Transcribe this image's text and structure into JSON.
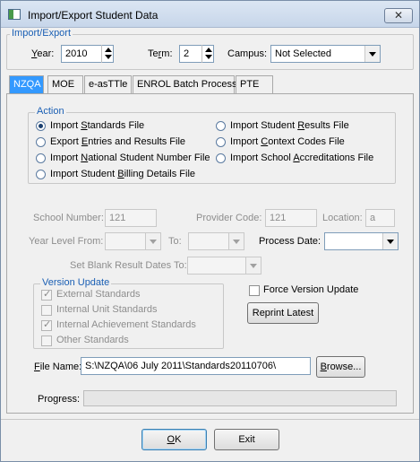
{
  "window": {
    "title": "Import/Export Student Data",
    "close_label": "✕"
  },
  "import_export": {
    "legend": "Import/Export",
    "year_label": "Year:",
    "year_value": "2010",
    "term_label": "Term:",
    "term_value": "2",
    "campus_label": "Campus:",
    "campus_value": "Not Selected"
  },
  "tabs": [
    "NZQA",
    "MOE",
    "e-asTTle",
    "ENROL Batch Process",
    "PTE"
  ],
  "action": {
    "legend": "Action",
    "options": [
      "Import Standards File",
      "Export Entries and Results File",
      "Import National Student Number File",
      "Import Student Billing Details File",
      "Import Student Results File",
      "Import Context Codes File",
      "Import School Accreditations File"
    ],
    "selected": "Import Standards File"
  },
  "fields": {
    "school_number_label": "School Number:",
    "school_number_value": "121",
    "provider_code_label": "Provider Code:",
    "provider_code_value": "121",
    "location_label": "Location:",
    "location_value": "a",
    "year_level_from_label": "Year Level From:",
    "to_label": "To:",
    "process_date_label": "Process Date:",
    "blank_result_label": "Set Blank Result Dates To:"
  },
  "version_update": {
    "legend": "Version Update",
    "options": [
      {
        "label": "External Standards",
        "checked": true
      },
      {
        "label": "Internal Unit Standards",
        "checked": false
      },
      {
        "label": "Internal Achievement Standards",
        "checked": true
      },
      {
        "label": "Other Standards",
        "checked": false
      }
    ],
    "force_label": "Force Version Update",
    "reprint_label": "Reprint Latest"
  },
  "file": {
    "label": "File Name:",
    "value": "S:\\NZQA\\06 July 2011\\Standards20110706\\",
    "browse_label": "Browse..."
  },
  "progress": {
    "label": "Progress:",
    "value": 0
  },
  "buttons": {
    "ok_label": "OK",
    "exit_label": "Exit"
  }
}
